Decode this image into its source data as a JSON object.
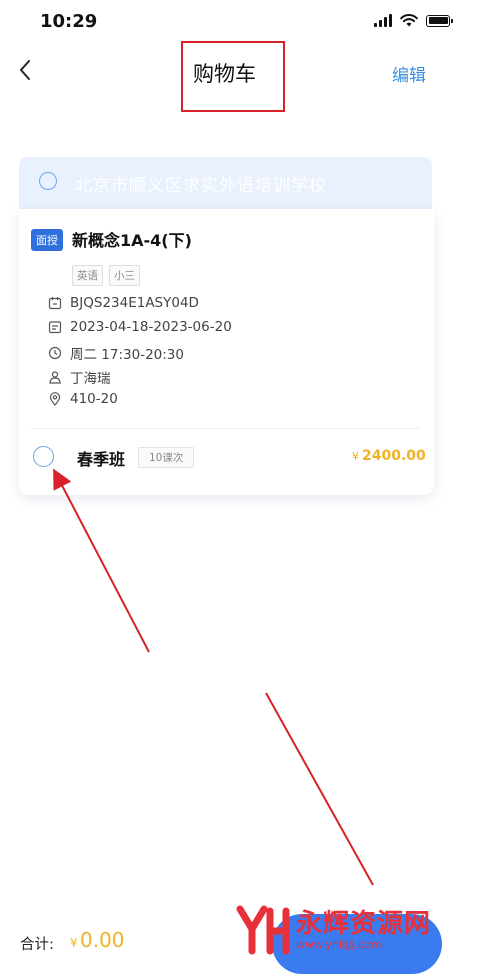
{
  "status_bar": {
    "time": "10:29"
  },
  "nav": {
    "title": "购物车",
    "edit_label": "编辑"
  },
  "school": {
    "name": "北京市顺义区求实外语培训学校"
  },
  "course": {
    "mode_tag": "面授",
    "name": "新概念1A-4(下)",
    "chips": [
      "英语",
      "小三"
    ],
    "info": [
      {
        "icon": "calendar-icon",
        "text": "BJQS234E1ASY04D"
      },
      {
        "icon": "date-range-icon",
        "text": "2023-04-18-2023-06-20"
      },
      {
        "icon": "clock-icon",
        "text": "周二  17:30-20:30"
      },
      {
        "icon": "teacher-icon",
        "text": "丁海瑞"
      },
      {
        "icon": "location-icon",
        "text": "410-20"
      }
    ],
    "class_name": "春季班",
    "lessons": "10课次",
    "currency": "¥",
    "price": "2400.00"
  },
  "footer": {
    "total_label": "合计:",
    "currency": "¥",
    "total_value": "0.00"
  },
  "watermark": {
    "name": "永辉资源网",
    "url": "www.yhkjjj.com"
  },
  "colors": {
    "accent": "#3a7cf0",
    "price": "#f0b323",
    "annotation": "#d8222a"
  }
}
